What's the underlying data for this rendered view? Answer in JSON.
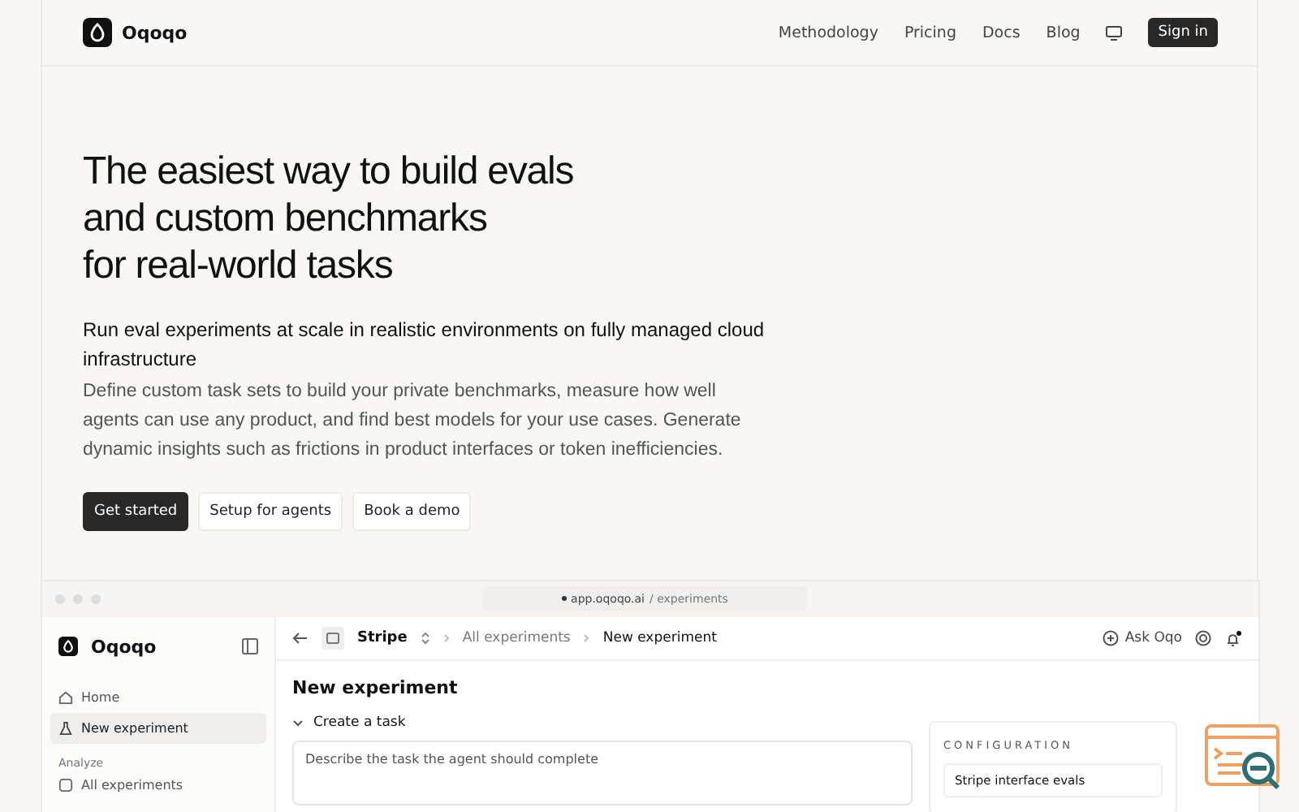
{
  "nav": {
    "brand": "Oqoqo",
    "links": [
      {
        "label": "Methodology"
      },
      {
        "label": "Pricing"
      },
      {
        "label": "Docs"
      },
      {
        "label": "Blog"
      }
    ],
    "signin": "Sign in"
  },
  "hero": {
    "title_lines": [
      "The easiest way to build evals",
      "and custom benchmarks",
      "for real-world tasks"
    ],
    "subtitle": "Run eval experiments at scale in realistic environments on fully managed cloud infrastructure",
    "description": "Define custom task sets to build your private benchmarks, measure how well agents can use any product, and find best models for your use cases. Generate dynamic insights such as frictions in product interfaces or token inefficiencies.",
    "buttons": [
      {
        "label": "Get started",
        "kind": "primary"
      },
      {
        "label": "Setup for agents",
        "kind": "secondary"
      },
      {
        "label": "Book a demo",
        "kind": "secondary"
      }
    ]
  },
  "preview": {
    "url_host": "app.oqoqo.ai",
    "url_path": "/ experiments",
    "sidebar": {
      "brand": "Oqoqo",
      "items": [
        {
          "label": "Home",
          "kind": "home",
          "selected": false
        },
        {
          "label": "New experiment",
          "kind": "flask",
          "selected": true
        }
      ],
      "section": "Analyze",
      "section_items": [
        {
          "label": "All experiments",
          "kind": "grid",
          "selected": false
        }
      ]
    },
    "topbar": {
      "workspace": "Stripe",
      "crumbs": [
        "All experiments",
        "New experiment"
      ],
      "ask": "Ask Oqo"
    },
    "heading": "New experiment",
    "section": "Create a task",
    "task_placeholder": "Describe the task the agent should complete",
    "config": {
      "label": "CONFIGURATION",
      "value": "Stripe interface evals"
    }
  }
}
